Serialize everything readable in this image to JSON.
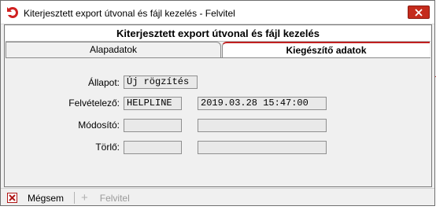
{
  "window": {
    "title": "Kiterjesztett export útvonal és fájl kezelés - Felvitel"
  },
  "form": {
    "header": "Kiterjesztett export útvonal és fájl kezelés"
  },
  "tabs": [
    {
      "label": "Alapadatok",
      "active": false
    },
    {
      "label": "Kiegészítő adatok",
      "active": true
    }
  ],
  "fields": {
    "allapot": {
      "label": "Állapot:",
      "value": "Új rögzítés"
    },
    "felvetelezo": {
      "label": "Felvételező:",
      "user": "HELPLINE",
      "datetime": "2019.03.28 15:47:00"
    },
    "modosito": {
      "label": "Módosító:",
      "user": "",
      "datetime": ""
    },
    "torlo": {
      "label": "Törlő:",
      "user": "",
      "datetime": ""
    }
  },
  "statusbar": {
    "cancel_label": "Mégsem",
    "add_label": "Felvitel"
  },
  "colors": {
    "close_button": "#c42b1c",
    "active_tab_accent": "#c02020",
    "cancel_icon": "#b01818"
  },
  "icons": [
    "app-logo-icon",
    "close-icon",
    "cancel-x-icon",
    "add-plus-icon"
  ]
}
